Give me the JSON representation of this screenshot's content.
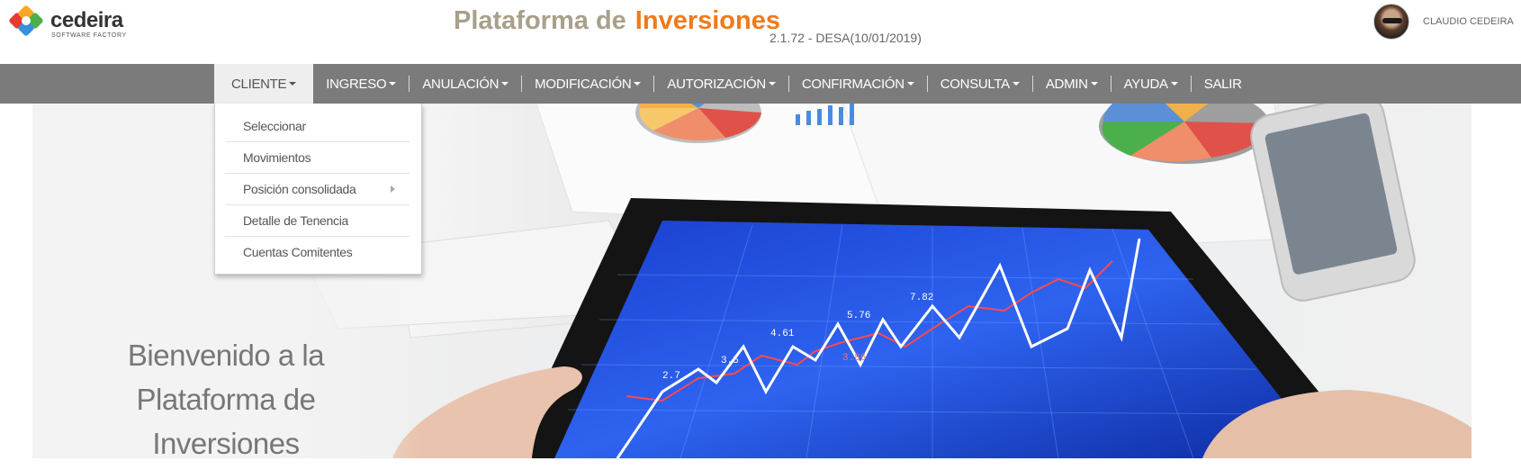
{
  "header": {
    "logo": {
      "word": "cedeira",
      "subtitle": "SOFTWARE FACTORY",
      "colors": [
        "#e63b2e",
        "#f7a823",
        "#3a8fd9",
        "#4bb04b"
      ]
    },
    "title_part1": "Plataforma de",
    "title_part2": "Inversiones",
    "version": "2.1.72 - DESA(10/01/2019)",
    "user": {
      "name": "CLAUDIO CEDEIRA",
      "avatar": "user-avatar"
    }
  },
  "nav": {
    "items": [
      {
        "label": "CLIENTE",
        "has_caret": true,
        "active": true
      },
      {
        "label": "INGRESO",
        "has_caret": true
      },
      {
        "label": "ANULACIÓN",
        "has_caret": true
      },
      {
        "label": "MODIFICACIÓN",
        "has_caret": true
      },
      {
        "label": "AUTORIZACIÓN",
        "has_caret": true
      },
      {
        "label": "CONFIRMACIÓN",
        "has_caret": true
      },
      {
        "label": "CONSULTA",
        "has_caret": true
      },
      {
        "label": "ADMIN",
        "has_caret": true
      },
      {
        "label": "AYUDA",
        "has_caret": true
      },
      {
        "label": "SALIR",
        "has_caret": false
      }
    ],
    "colors": {
      "bar": "#7b7b7b",
      "active_bg": "#eeeeee"
    }
  },
  "dropdown": {
    "items": [
      {
        "label": "Seleccionar"
      },
      {
        "label": "Movimientos"
      },
      {
        "label": "Posición consolidada",
        "submenu": true
      },
      {
        "label": "Detalle de Tenencia"
      },
      {
        "label": "Cuentas Comitentes"
      }
    ]
  },
  "hero": {
    "welcome_line1": "Bienvenido a la",
    "welcome_line2": "Plataforma de Inversiones",
    "chart_labels": [
      "2.7",
      "3.5",
      "4.61",
      "5.76",
      "7.82",
      "3.86"
    ]
  },
  "colors": {
    "title_gray": "#a8a08a",
    "title_orange": "#f07a1a"
  }
}
